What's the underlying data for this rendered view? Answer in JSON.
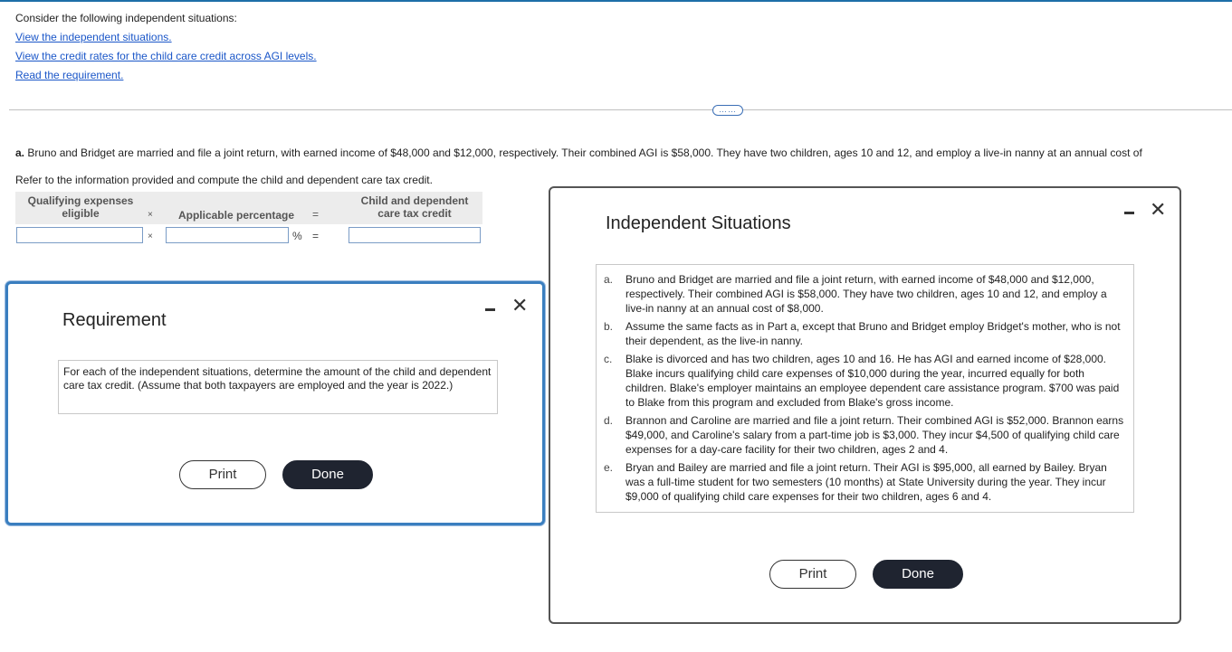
{
  "intro": "Consider the following independent situations:",
  "links": {
    "situations": "View the independent situations.",
    "credit_rates": "View the credit rates for the child care credit across AGI levels.",
    "requirement": "Read the requirement."
  },
  "more_button": "……",
  "question": {
    "label": "a.",
    "text": " Bruno and Bridget are married and file a joint return, with earned income of $48,000 and $12,000, respectively. Their combined AGI is $58,000. They have two children, ages 10 and 12, and employ a live-in nanny at an annual cost of"
  },
  "refer": "Refer to the information provided and compute the child and dependent care tax credit.",
  "calc": {
    "col1_line1": "Qualifying expenses",
    "col1_line2": "eligible",
    "times": "×",
    "col2": "Applicable percentage",
    "equals": "=",
    "col3_line1": "Child and dependent",
    "col3_line2": "care tax credit",
    "expense_value": "",
    "percentage_value": "",
    "credit_value": "",
    "percent_sign": "%"
  },
  "requirement_modal": {
    "title": "Requirement",
    "body": "For each of the independent situations, determine the amount of the child and dependent care tax credit. (Assume that both taxpayers are employed and the year is 2022.)",
    "print": "Print",
    "done": "Done"
  },
  "situations_modal": {
    "title": "Independent Situations",
    "items": [
      {
        "letter": "a.",
        "text": "Bruno and Bridget are married and file a joint return, with earned income of $48,000 and $12,000, respectively. Their combined AGI is $58,000. They have two children, ages 10 and 12, and employ a live-in nanny at an annual cost of $8,000."
      },
      {
        "letter": "b.",
        "text": "Assume the same facts as in Part a, except that Bruno and Bridget employ Bridget's mother, who is not their dependent, as the live-in nanny."
      },
      {
        "letter": "c.",
        "text": "Blake is divorced and has two children, ages 10 and 16. He has AGI and earned income of $28,000. Blake incurs qualifying child care expenses of $10,000 during the year, incurred equally for both children. Blake's employer maintains an employee dependent care assistance program. $700 was paid to Blake from this program and excluded from Blake's gross income."
      },
      {
        "letter": "d.",
        "text": "Brannon and Caroline are married and file a joint return. Their combined AGI is $52,000. Brannon earns $49,000, and Caroline's salary from a part-time job is $3,000. They incur $4,500 of qualifying child care expenses for a day-care facility for their two children, ages 2 and 4."
      },
      {
        "letter": "e.",
        "text": "Bryan and Bailey are married and file a joint return. Their AGI is $95,000, all earned by Bailey. Bryan was a full-time student for two semesters (10 months) at State University during the year. They incur $9,000 of qualifying child care expenses for their two children, ages 6 and 4."
      }
    ],
    "print": "Print",
    "done": "Done"
  },
  "colors": {
    "link": "#1a56c8",
    "modal_focus_border": "#3a7ebf",
    "done_button": "#1f2430",
    "input_border": "#7a9cc6"
  }
}
